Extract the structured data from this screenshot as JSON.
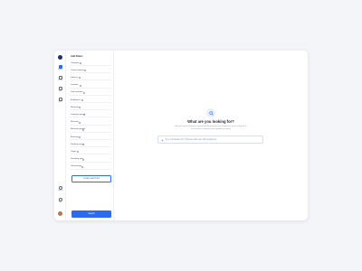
{
  "nav": {
    "items": [
      {
        "label": "Search",
        "active": true
      },
      {
        "label": "AI Lists",
        "active": false
      },
      {
        "label": "Lists",
        "active": false
      },
      {
        "label": "Plans",
        "active": false
      }
    ],
    "bottom": [
      {
        "label": "Settings"
      },
      {
        "label": "Help"
      }
    ]
  },
  "filters": {
    "title": "Add Filters",
    "items": [
      "Company",
      "Contact person",
      "Industry",
      "Location",
      "Total locations",
      "Employees",
      "Revenue",
      "Company growth",
      "Revenue",
      "Revenue growth",
      "Earnings",
      "Funding rounds",
      "Target",
      "Founding year",
      "Job postings"
    ],
    "create_label": "Create search list",
    "search_label": "Search"
  },
  "main": {
    "title": "What are you looking for?",
    "subtitle": "Start your search by typing a prompt describing the ideal list of companies you're looking for, or use our filters to find your perfect prospects instantly.",
    "search_placeholder": "E.g. Companies in IT industry with over 100 employees"
  },
  "colors": {
    "accent": "#2a6bf2",
    "background": "#f4f5f8"
  },
  "icons": {
    "hero": "search-icon",
    "sparkle": "sparkle-icon"
  }
}
